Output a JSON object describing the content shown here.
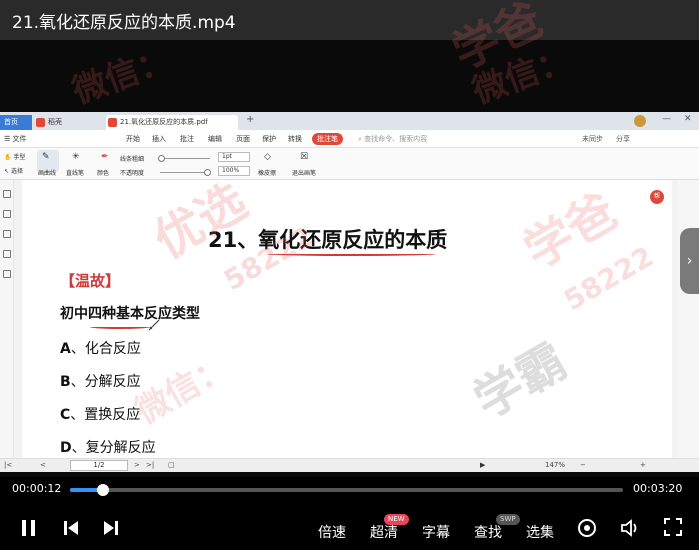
{
  "video": {
    "title": "21.氧化还原反应的本质.mp4",
    "current_time": "00:00:12",
    "total_time": "00:03:20",
    "progress": 0.06
  },
  "wps": {
    "tabs": {
      "home": "首页",
      "docer": "稻壳",
      "pdf": "21.氧化还原反应的本质.pdf"
    },
    "menu": {
      "file": "文件",
      "items": [
        "开始",
        "插入",
        "批注",
        "编辑",
        "页面",
        "保护",
        "转换"
      ],
      "active": "批注笔",
      "search_placeholder": "查找命令、搜索内容",
      "right_items": [
        "未同步",
        "分享"
      ]
    },
    "toolbar": {
      "hand": "手型",
      "select": "选择",
      "freehand": "画曲线",
      "straight": "直线笔",
      "color": "颜色",
      "line_thickness": "线条粗细",
      "opacity": "不透明度",
      "thickness_value": "1pt",
      "opacity_value": "100%",
      "eraser": "橡皮擦",
      "exit": "退出画笔"
    },
    "status": {
      "page": "1/2",
      "zoom": "147%"
    },
    "badge": "帮"
  },
  "document": {
    "title": "21、氧化还原反应的本质",
    "review_label": "【温故】",
    "subtitle": "初中四种基本反应类型",
    "options": [
      {
        "letter": "A",
        "text": "、化合反应"
      },
      {
        "letter": "B",
        "text": "、分解反应"
      },
      {
        "letter": "C",
        "text": "、置换反应"
      },
      {
        "letter": "D",
        "text": "、复分解反应"
      }
    ]
  },
  "watermarks": {
    "w1": "学爸",
    "w2": "58222",
    "w3": "微信：",
    "w4": "优选",
    "w5": "学霸"
  },
  "controls": {
    "speed": "倍速",
    "quality": "超清",
    "quality_badge": "NEW",
    "subtitles": "字幕",
    "find": "查找",
    "find_badge": "SWP",
    "episodes": "选集"
  },
  "colors": {
    "progress": "#3a8ef6",
    "accent_red": "#e0483a"
  }
}
